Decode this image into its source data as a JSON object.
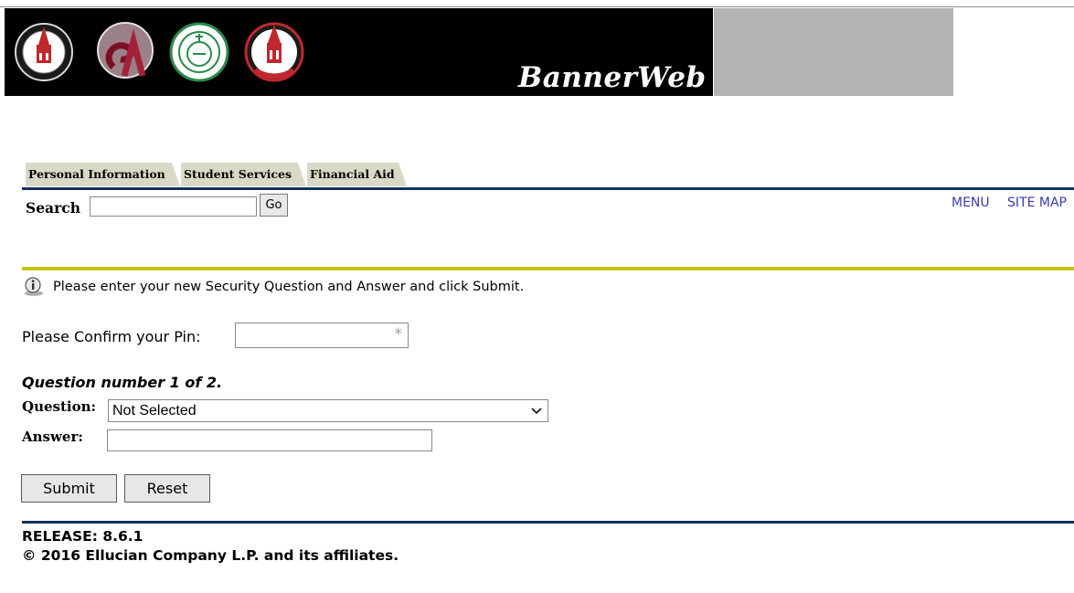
{
  "header": {
    "brand": "BannerWeb",
    "logos": [
      "uiw-seal-icon",
      "sa-monogram-icon",
      "ihs-seal-icon",
      "uiw-prep-tower-icon"
    ],
    "colors": {
      "banner_bg": "#000000",
      "banner_side": "#b3b3b3"
    }
  },
  "tabs": [
    {
      "label": "Personal Information"
    },
    {
      "label": "Student Services"
    },
    {
      "label": "Financial Aid"
    }
  ],
  "search": {
    "label": "Search",
    "value": "",
    "go_label": "Go"
  },
  "toplinks": {
    "menu": "MENU",
    "site_map": "SITE MAP"
  },
  "info": {
    "message": "Please enter your new Security Question and Answer and click Submit."
  },
  "form": {
    "pin_label": "Please Confirm your Pin:",
    "pin_value": "",
    "pin_required_mark": "*",
    "question_heading": "Question number 1 of 2.",
    "question_label": "Question:",
    "question_selected": "Not Selected",
    "answer_label": "Answer:",
    "answer_value": ""
  },
  "buttons": {
    "submit": "Submit",
    "reset": "Reset"
  },
  "footer": {
    "release": "RELEASE: 8.6.1",
    "copyright": "© 2016 Ellucian Company L.P. and its affiliates."
  }
}
